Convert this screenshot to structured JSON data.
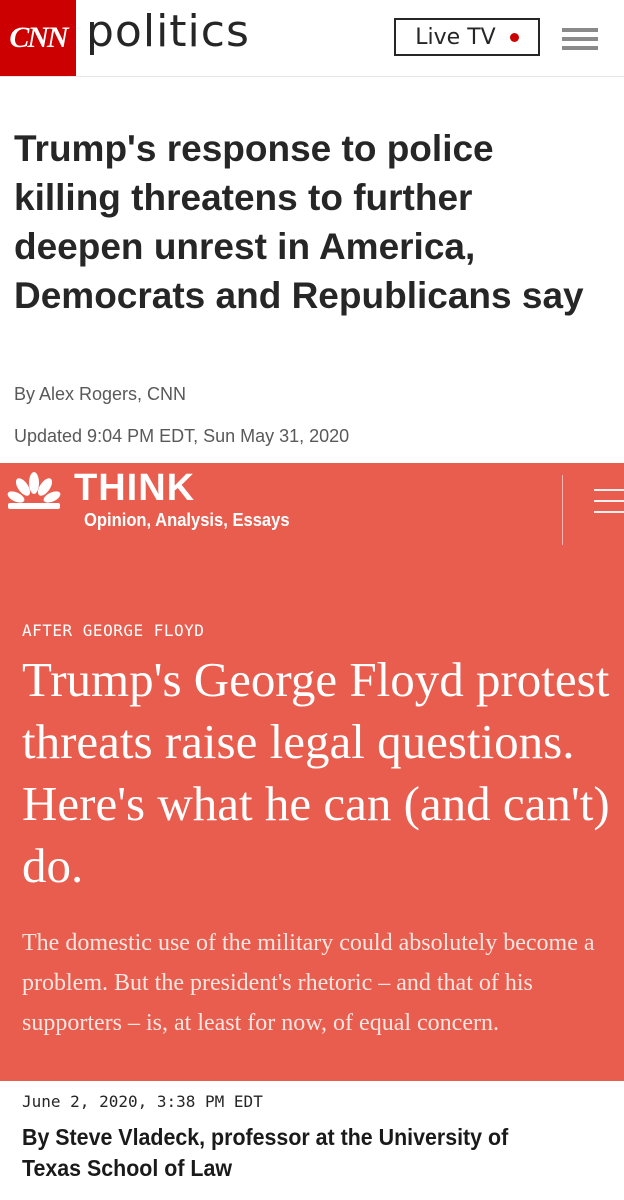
{
  "cnn": {
    "logo_text": "CNN",
    "section": "politics",
    "live_tv_label": "Live TV",
    "headline": "Trump's response to police killing threatens to further deepen unrest in America, Democrats and Republicans say",
    "byline": "By Alex Rogers, CNN",
    "updated": "Updated 9:04 PM EDT, Sun May 31, 2020",
    "colors": {
      "brand_red": "#cc0000",
      "text": "#262626",
      "meta": "#595959"
    }
  },
  "think": {
    "logo_icon": "nbc-peacock-icon",
    "title": "THINK",
    "subtitle": "Opinion, Analysis, Essays",
    "kicker": "AFTER GEORGE FLOYD",
    "headline": "Trump's George Floyd protest threats raise legal questions. Here's what he can (and can't) do.",
    "dek": "The domestic use of the military could absolutely become a problem. But the president's rhetoric – and that of his supporters – is, at least for now, of equal concern.",
    "date": "June 2, 2020, 3:38 PM EDT",
    "byline": "By Steve Vladeck, professor at the University of Texas School of Law",
    "colors": {
      "background": "#e95d4e",
      "text": "#ffffff"
    }
  }
}
